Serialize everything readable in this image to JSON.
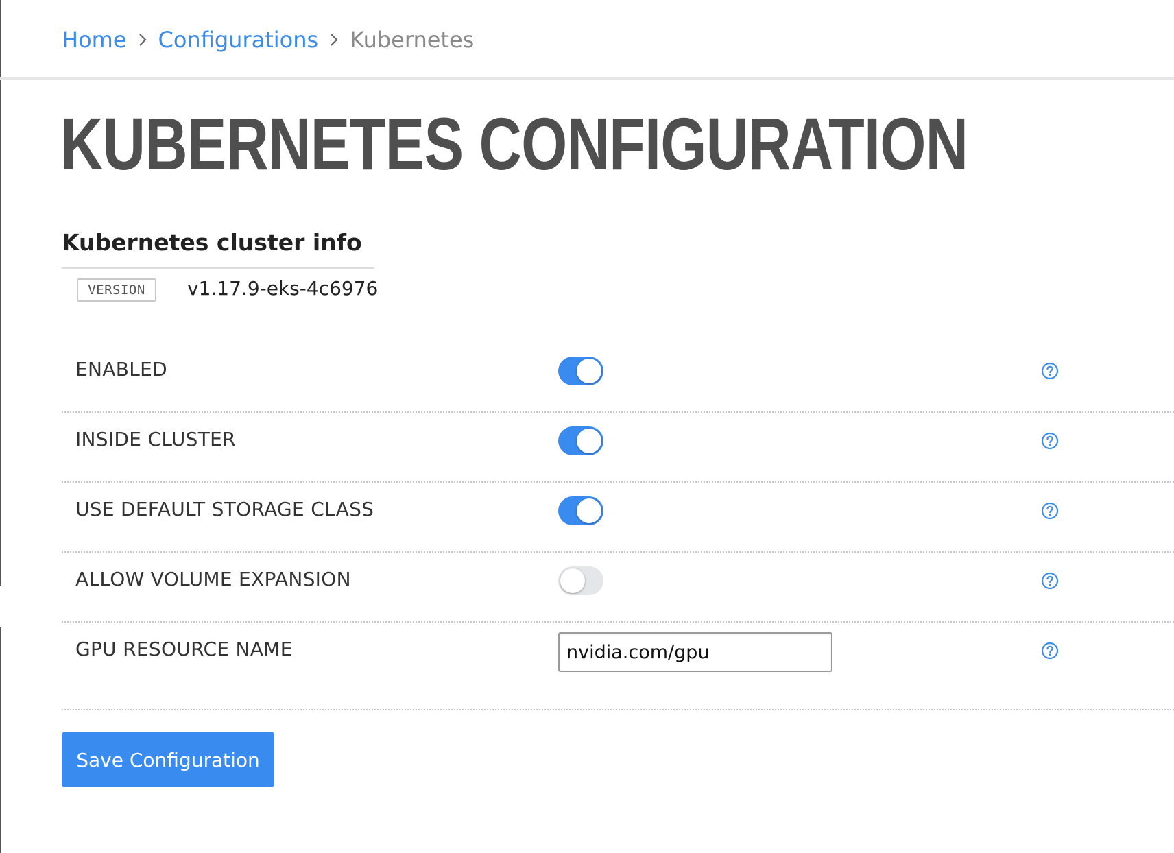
{
  "breadcrumb": {
    "items": [
      {
        "label": "Home"
      },
      {
        "label": "Configurations"
      },
      {
        "label": "Kubernetes"
      }
    ]
  },
  "page": {
    "title": "KUBERNETES CONFIGURATION"
  },
  "cluster_info": {
    "heading": "Kubernetes cluster info",
    "version_tag": "VERSION",
    "version_value": "v1.17.9-eks-4c6976"
  },
  "settings": {
    "rows": [
      {
        "label": "ENABLED",
        "control": "toggle",
        "enabled": true
      },
      {
        "label": "INSIDE CLUSTER",
        "control": "toggle",
        "enabled": true
      },
      {
        "label": "USE DEFAULT STORAGE CLASS",
        "control": "toggle",
        "enabled": true
      },
      {
        "label": "ALLOW VOLUME EXPANSION",
        "control": "toggle",
        "enabled": false
      },
      {
        "label": "GPU RESOURCE NAME",
        "control": "text",
        "value": "nvidia.com/gpu"
      }
    ]
  },
  "actions": {
    "save_label": "Save Configuration"
  },
  "colors": {
    "accent": "#3a8bf0",
    "link": "#3d8ce8",
    "title": "#4f4f4f",
    "toggle_off": "#e4e6ea"
  },
  "icons": {
    "breadcrumb_separator": "chevron-right-icon",
    "help": "question-circle-icon"
  }
}
